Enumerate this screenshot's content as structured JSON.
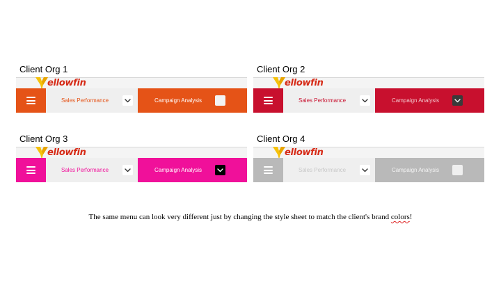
{
  "orgs": [
    {
      "title": "Client Org 1",
      "logo_text": "ellowfin",
      "tab1_label": "Sales Performance",
      "tab2_label": "Campaign Analysis",
      "colors": {
        "hamburger_bg": "#e55317",
        "tab1_text": "#e55317",
        "tab2_bg": "#e55317",
        "tab2_text": "#ffffff",
        "chev2_bg": "#f3f3f3",
        "chev2_color": "#f3f3f3"
      }
    },
    {
      "title": "Client Org 2",
      "logo_text": "ellowfin",
      "tab1_label": "Sales Performance",
      "tab2_label": "Campaign Analysis",
      "colors": {
        "hamburger_bg": "#c8102e",
        "tab1_text": "#c8102e",
        "tab2_bg": "#c8102e",
        "tab2_text": "#f3c6cc",
        "chev2_bg": "#3a3a3a",
        "chev2_color": "#ffffff"
      }
    },
    {
      "title": "Client Org 3",
      "logo_text": "ellowfin",
      "tab1_label": "Sales Performance",
      "tab2_label": "Campaign Analysis",
      "colors": {
        "hamburger_bg": "#f0109a",
        "tab1_text": "#f0109a",
        "tab2_bg": "#f0109a",
        "tab2_text": "#ffffff",
        "chev2_bg": "#000000",
        "chev2_color": "#ffffff"
      }
    },
    {
      "title": "Client Org 4",
      "logo_text": "ellowfin",
      "tab1_label": "Sales Performance",
      "tab2_label": "Campaign Analysis",
      "colors": {
        "hamburger_bg": "#b9b9b9",
        "tab1_text": "#c8c8c8",
        "tab2_bg": "#b9b9b9",
        "tab2_text": "#f4f4f4",
        "chev2_bg": "#efefef",
        "chev2_color": "#efefef"
      }
    }
  ],
  "caption": {
    "before": "The same menu can look very different just by changing the style sheet to match the client's brand ",
    "underlined": "colors",
    "after": "!"
  },
  "icons": {
    "logo": "yellowfin-logo-icon",
    "menu": "hamburger-menu-icon",
    "dropdown": "chevron-down-icon"
  }
}
